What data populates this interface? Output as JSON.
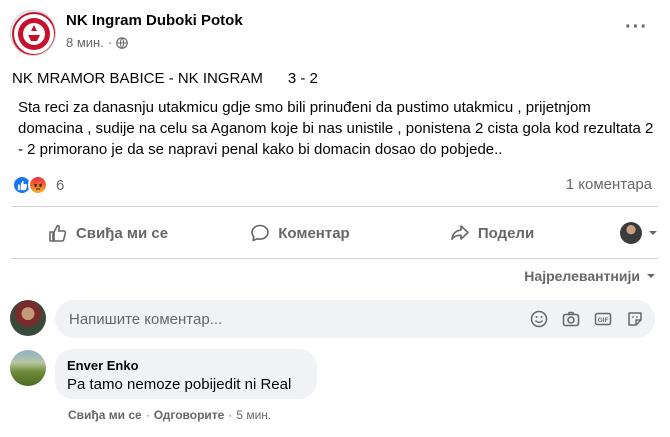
{
  "post": {
    "page_name": "NK Ingram Duboki Potok",
    "time": "8 мин.",
    "audience_icon": "globe-icon",
    "title": "NK MRAMOR BABICE - NK INGRAM      3 - 2",
    "body": "Sta reci za danasnju utakmicu  gdje smo bili prinuđeni da pustimo utakmicu ,  prijetnjom domacina , sudije na celu sa Aganom koje bi nas unistile , ponistena 2 cista gola kod rezultata 2 - 2  primorano je da se napravi penal kako bi domacin dosao do pobjede.."
  },
  "reactions": {
    "icons": [
      "like",
      "angry"
    ],
    "count": "6",
    "comments_count": "1 коментара"
  },
  "actions": {
    "like": "Свиђа ми се",
    "comment": "Коментар",
    "share": "Подели"
  },
  "sort": {
    "label": "Најрелевантнији"
  },
  "composer": {
    "placeholder": "Напишите коментар..."
  },
  "comment": {
    "author": "Enver Enko",
    "text": "Pa tamo nemoze pobijedit ni Real",
    "like": "Свиђа ми се",
    "reply": "Одговорите",
    "time": "5 мин."
  },
  "colors": {
    "accent": "#1877f2",
    "muted": "#65676b",
    "bubble": "#f0f2f5"
  }
}
